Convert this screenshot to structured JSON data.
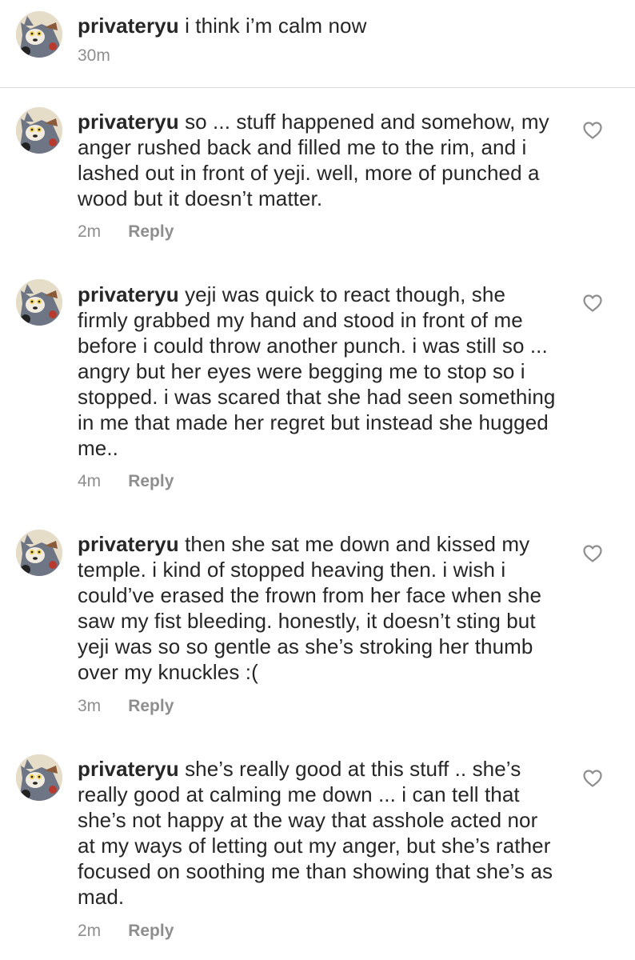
{
  "caption": {
    "username": "privateryu",
    "text": "i think i’m calm now",
    "time": "30m"
  },
  "comments": [
    {
      "username": "privateryu",
      "text": "so ... stuff happened and somehow, my anger rushed back and filled me to the rim, and i lashed out in front of yeji. well, more of punched a wood but it doesn’t matter.",
      "time": "2m",
      "reply_label": "Reply"
    },
    {
      "username": "privateryu",
      "text": "yeji was quick to react though, she firmly grabbed my hand and stood in front of me before i could throw another punch. i was still so ... angry but her eyes were begging me to stop so i stopped. i was scared that she had seen something in me that made her regret but instead she hugged me..",
      "time": "4m",
      "reply_label": "Reply"
    },
    {
      "username": "privateryu",
      "text": "then she sat me down and kissed my temple. i kind of stopped heaving then. i wish i could’ve erased the frown from her face when she saw my fist bleeding. honestly, it doesn’t sting but yeji was so so gentle as she’s stroking her thumb over my knuckles :(",
      "time": "3m",
      "reply_label": "Reply"
    },
    {
      "username": "privateryu",
      "text": "she’s really good at this stuff .. she’s really good at calming me down ... i can tell that she’s not happy at the way that asshole acted nor at my ways of letting out my anger, but she’s rather focused on soothing me than showing that she’s as mad.",
      "time": "2m",
      "reply_label": "Reply"
    }
  ],
  "icons": {
    "avatar": "cartoon-cat-avatar",
    "like": "heart-outline-icon"
  },
  "colors": {
    "text": "#262626",
    "secondary": "#8e8e8e",
    "divider": "#dbdbdb"
  }
}
